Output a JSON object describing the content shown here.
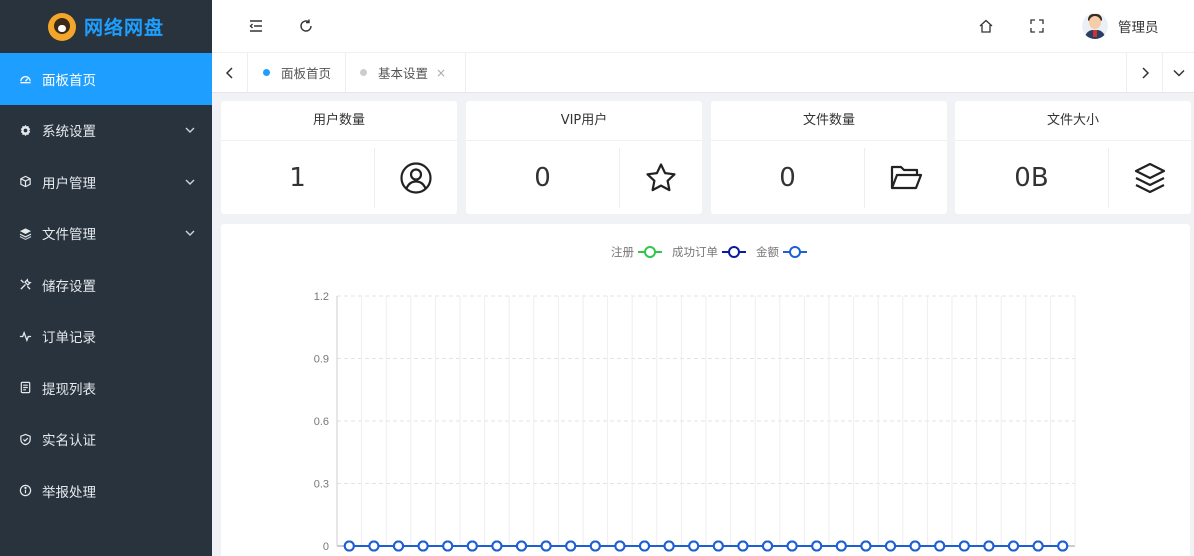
{
  "app": {
    "title": "网络网盘"
  },
  "sidebar": {
    "items": [
      {
        "label": "面板首页",
        "icon": "dashboard-icon",
        "active": true,
        "has_sub": false
      },
      {
        "label": "系统设置",
        "icon": "gear-icon",
        "active": false,
        "has_sub": true
      },
      {
        "label": "用户管理",
        "icon": "cube-icon",
        "active": false,
        "has_sub": true
      },
      {
        "label": "文件管理",
        "icon": "layers-icon",
        "active": false,
        "has_sub": true
      },
      {
        "label": "储存设置",
        "icon": "tools-icon",
        "active": false,
        "has_sub": false
      },
      {
        "label": "订单记录",
        "icon": "pulse-icon",
        "active": false,
        "has_sub": false
      },
      {
        "label": "提现列表",
        "icon": "list-icon",
        "active": false,
        "has_sub": false
      },
      {
        "label": "实名认证",
        "icon": "shield-check-icon",
        "active": false,
        "has_sub": false
      },
      {
        "label": "举报处理",
        "icon": "info-circle-icon",
        "active": false,
        "has_sub": false
      }
    ]
  },
  "header": {
    "user_name": "管理员"
  },
  "tabs": [
    {
      "label": "面板首页",
      "active": true,
      "closable": false
    },
    {
      "label": "基本设置",
      "active": false,
      "closable": true
    }
  ],
  "tab_close_glyph": "×",
  "stats": [
    {
      "title": "用户数量",
      "value": "1",
      "icon": "user-circle-icon"
    },
    {
      "title": "VIP用户",
      "value": "0",
      "icon": "star-icon"
    },
    {
      "title": "文件数量",
      "value": "0",
      "icon": "folder-open-icon"
    },
    {
      "title": "文件大小",
      "value": "0B",
      "icon": "layers-icon"
    }
  ],
  "colors": {
    "sidebar_bg": "#28333e",
    "accent": "#1e9fff",
    "series_1": "#2ec74c",
    "series_2": "#0a1a9c",
    "series_3": "#1f5fd6"
  },
  "chart_data": {
    "type": "line",
    "legend_position": "top-center",
    "grid": true,
    "ylim": [
      0,
      1.2
    ],
    "y_ticks": [
      "1.2",
      "0.9",
      "0.6",
      "0.3",
      "0"
    ],
    "point_count": 30,
    "series": [
      {
        "name": "注册",
        "color": "#2ec74c",
        "values": [
          0,
          0,
          0,
          0,
          0,
          0,
          0,
          0,
          0,
          0,
          0,
          0,
          0,
          0,
          0,
          0,
          0,
          0,
          0,
          0,
          0,
          0,
          0,
          0,
          0,
          0,
          0,
          0,
          0,
          0
        ]
      },
      {
        "name": "成功订单",
        "color": "#0a1a9c",
        "values": [
          0,
          0,
          0,
          0,
          0,
          0,
          0,
          0,
          0,
          0,
          0,
          0,
          0,
          0,
          0,
          0,
          0,
          0,
          0,
          0,
          0,
          0,
          0,
          0,
          0,
          0,
          0,
          0,
          0,
          0
        ]
      },
      {
        "name": "金额",
        "color": "#1f5fd6",
        "values": [
          0,
          0,
          0,
          0,
          0,
          0,
          0,
          0,
          0,
          0,
          0,
          0,
          0,
          0,
          0,
          0,
          0,
          0,
          0,
          0,
          0,
          0,
          0,
          0,
          0,
          0,
          0,
          0,
          0,
          0
        ]
      }
    ]
  }
}
